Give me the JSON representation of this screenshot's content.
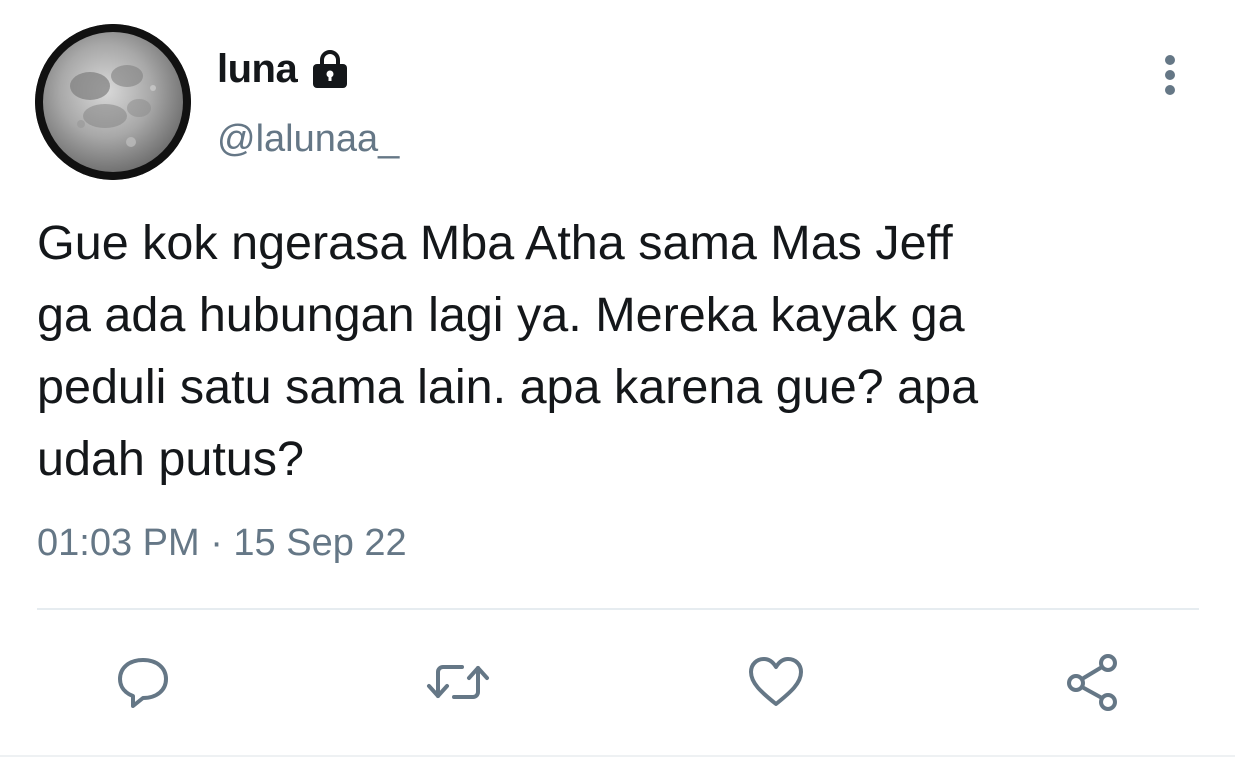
{
  "tweet": {
    "display_name": "luna",
    "handle": "@lalunaa_",
    "protected": true,
    "text": "Gue kok ngerasa Mba Atha sama Mas Jeff\nga ada hubungan lagi ya. Mereka kayak ga\npeduli satu sama lain. apa karena gue? apa\nudah putus?",
    "timestamp": "01:03 PM · 15 Sep 22"
  },
  "icons": {
    "lock": "lock-icon",
    "more": "more-vertical-icon",
    "reply": "reply-icon",
    "retweet": "retweet-icon",
    "like": "heart-icon",
    "share": "share-icon"
  },
  "colors": {
    "text_primary": "#14171a",
    "text_secondary": "#657786",
    "icon_gray": "#657786",
    "divider": "#e6ecf0"
  }
}
